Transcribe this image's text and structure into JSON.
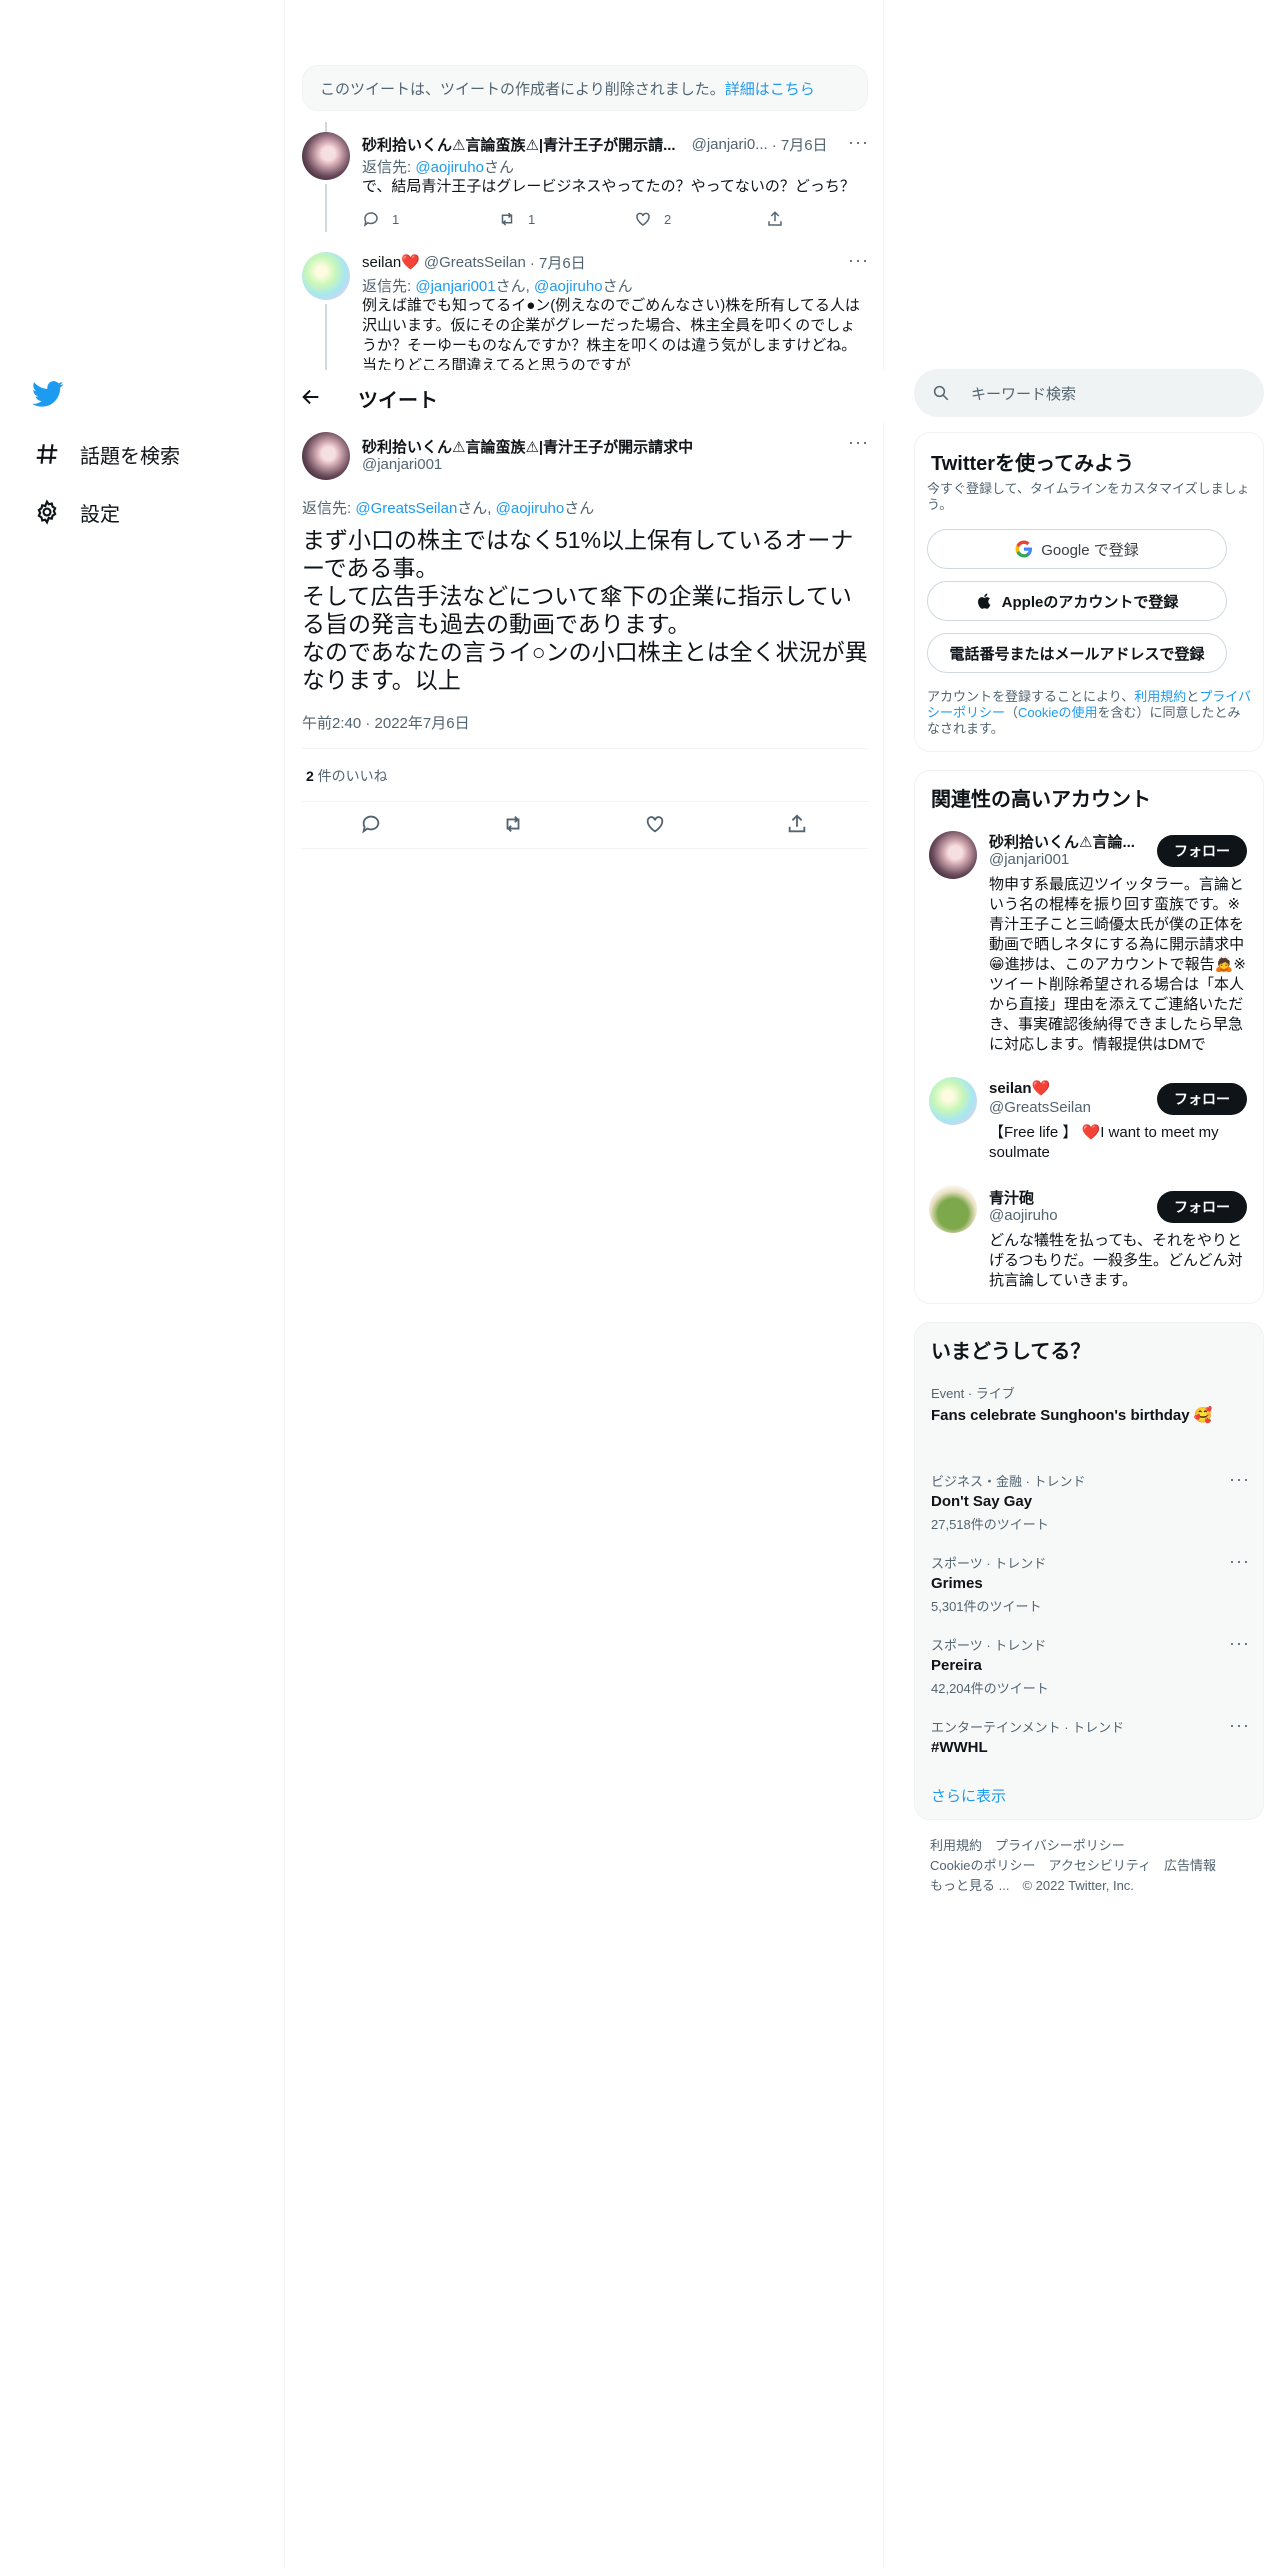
{
  "nav": {
    "explore_label": "話題を検索",
    "settings_label": "設定"
  },
  "main": {
    "deleted_notice": {
      "text": "このツイートは、ツイートの作成者により削除されました。",
      "link": "詳細はこちら"
    },
    "reply1": {
      "name": "砂利拾いくん⚠言論蛮族⚠|青汁王子が開示請...",
      "handle": "@janjari0...",
      "date": "· 7月6日",
      "reply_prefix": "返信先: ",
      "reply_handle": "@aojiruho",
      "reply_suffix": "さん",
      "text": "で、結局青汁王子はグレービジネスやってたの？やってないの？どっち？",
      "replies": "1",
      "retweets": "1",
      "likes": "2"
    },
    "reply2": {
      "name": "seilan❤️",
      "handle": "@GreatsSeilan",
      "date": "· 7月6日",
      "reply_prefix": "返信先: ",
      "reply_handle1": "@janjari001",
      "reply_mid": "さん, ",
      "reply_handle2": "@aojiruho",
      "reply_suffix": "さん",
      "text": "例えば誰でも知ってるイ●ン(例えなのでごめんなさい)株を所有してる人は沢山います。仮にその企業がグレーだった場合、株主全員を叩くのでしょうか？そーゆーものなんですか？株主を叩くのは違う気がしますけどね。当たりどころ間違えてると思うのですが"
    },
    "header_title": "ツイート",
    "focal": {
      "name": "砂利拾いくん⚠言論蛮族⚠|青汁王子が開示請求中",
      "handle": "@janjari001",
      "reply_prefix": "返信先: ",
      "reply_handle1": "@GreatsSeilan",
      "reply_mid": "さん, ",
      "reply_handle2": "@aojiruho",
      "reply_suffix": "さん",
      "line1": "まず小口の株主ではなく51%以上保有しているオーナーである事。",
      "line2": "そして広告手法などについて傘下の企業に指示している旨の発言も過去の動画であります。",
      "line3": "なのであなたの言うイ○ンの小口株主とは全く状況が異なります。以上",
      "timestamp": "午前2:40 · 2022年7月6日",
      "likes_count": "2",
      "likes_label": " 件のいいね"
    }
  },
  "sidebar": {
    "search_placeholder": "キーワード検索",
    "signup": {
      "title": "Twitterを使ってみよう",
      "subtitle": "今すぐ登録して、タイムラインをカスタマイズしましょう。",
      "google_btn": "Google で登録",
      "apple_btn": "Appleのアカウントで登録",
      "phone_btn": "電話番号またはメールアドレスで登録",
      "terms_pre": "アカウントを登録することにより、",
      "terms_link1": "利用規約",
      "terms_and": "と",
      "terms_link2": "プライバシーポリシー",
      "terms_paren_open": "（",
      "terms_link3": "Cookieの使用",
      "terms_post": "を含む）に同意したとみなされます。"
    },
    "relevant": {
      "title": "関連性の高いアカウント",
      "follow_label": "フォロー",
      "accounts": [
        {
          "name": "砂利拾いくん⚠言論...",
          "handle": "@janjari001",
          "bio": "物申す系最底辺ツイッタラー。言論という名の棍棒を振り回す蛮族です。※青汁王子こと三崎優太氏が僕の正体を動画で晒しネタにする為に開示請求中😁進捗は、このアカウントで報告🙇※ツイート削除希望される場合は「本人から直接」理由を添えてご連絡いただき、事実確認後納得できましたら早急に対応します。情報提供はDMで"
        },
        {
          "name": "seilan❤️",
          "handle": "@GreatsSeilan",
          "bio": "【Free life 】 ❤️I want to meet my soulmate"
        },
        {
          "name": "青汁砲",
          "handle": "@aojiruho",
          "bio": "どんな犠牲を払っても、それをやりとげるつもりだ。一殺多生。どんどん対抗言論していきます。"
        }
      ]
    },
    "trends": {
      "title": "いまどうしてる？",
      "items": [
        {
          "meta": "Event · ライブ",
          "name": "Fans celebrate Sunghoon's birthday 🥰",
          "count": ""
        },
        {
          "meta": "ビジネス・金融 · トレンド",
          "name": "Don't Say Gay",
          "count": "27,518件のツイート"
        },
        {
          "meta": "スポーツ · トレンド",
          "name": "Grimes",
          "count": "5,301件のツイート"
        },
        {
          "meta": "スポーツ · トレンド",
          "name": "Pereira",
          "count": "42,204件のツイート"
        },
        {
          "meta": "エンターテインメント · トレンド",
          "name": "#WWHL",
          "count": ""
        }
      ],
      "show_more": "さらに表示"
    },
    "footer": {
      "line1": "利用規約　プライバシーポリシー",
      "line2": "Cookieのポリシー　アクセシビリティ　広告情報",
      "line3": "もっと見る ...　© 2022 Twitter, Inc."
    }
  },
  "colors": {
    "accent": "#1d9bf0",
    "text": "#0f1419",
    "muted": "#536471",
    "border": "#eff3f4"
  }
}
